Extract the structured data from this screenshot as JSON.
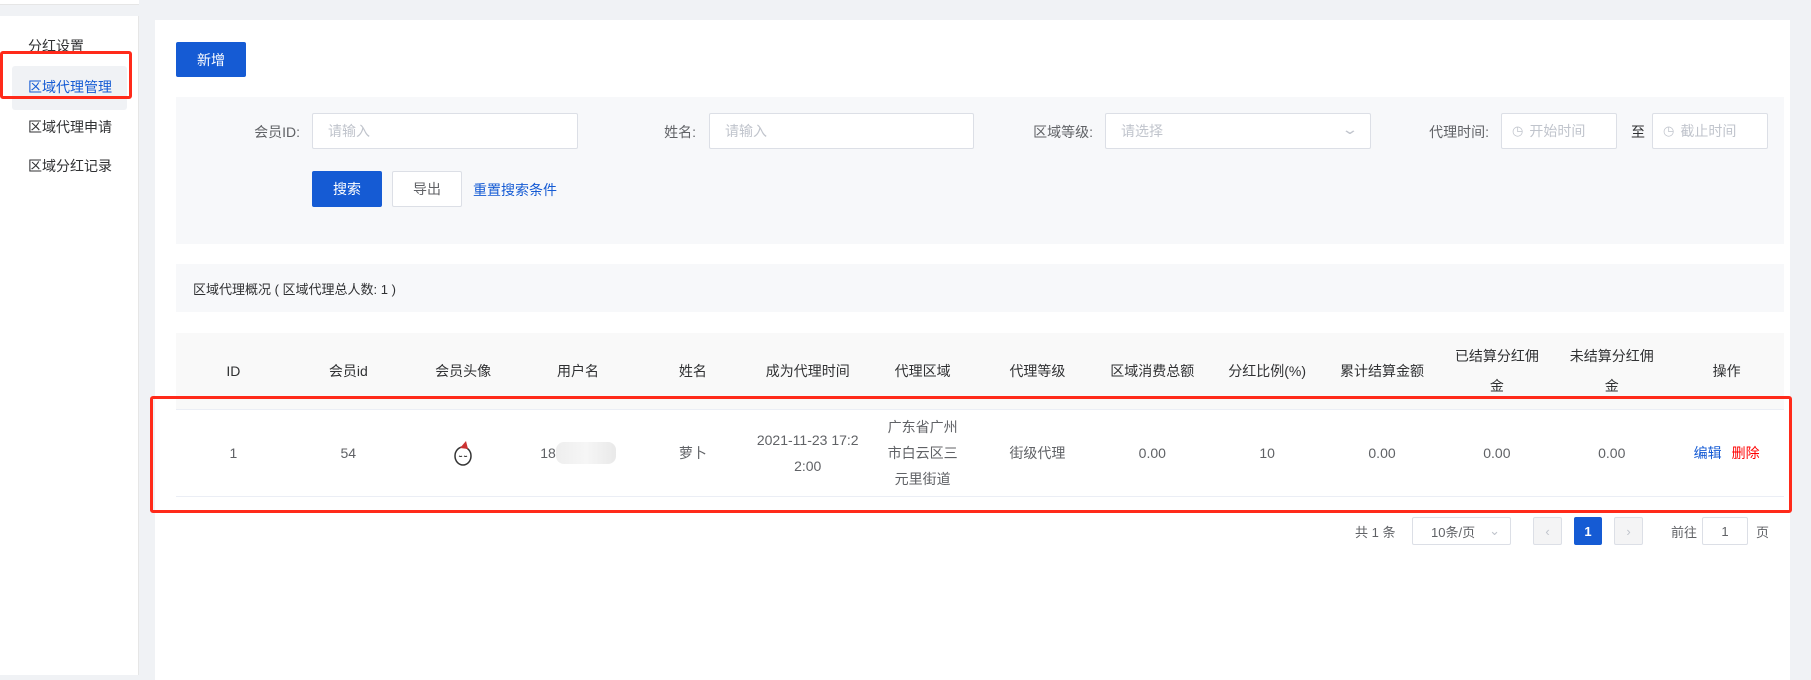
{
  "sidebar": {
    "items": [
      {
        "label": "分红设置"
      },
      {
        "label": "区域代理管理"
      },
      {
        "label": "区域代理申请"
      },
      {
        "label": "区域分红记录"
      }
    ]
  },
  "toolbar": {
    "add_label": "新增"
  },
  "filters": {
    "member_id": {
      "label": "会员ID:",
      "placeholder": "请输入"
    },
    "name": {
      "label": "姓名:",
      "placeholder": "请输入"
    },
    "level": {
      "label": "区域等级:",
      "placeholder": "请选择"
    },
    "time": {
      "label": "代理时间:",
      "start_placeholder": "开始时间",
      "sep": "至",
      "end_placeholder": "截止时间"
    },
    "search_label": "搜索",
    "export_label": "导出",
    "reset_label": "重置搜索条件"
  },
  "summary": {
    "text": "区域代理概况 ( 区域代理总人数: 1 )"
  },
  "table": {
    "headers": [
      "ID",
      "会员id",
      "会员头像",
      "用户名",
      "姓名",
      "成为代理时间",
      "代理区域",
      "代理等级",
      "区域消费总额",
      "分红比例(%)",
      "累计结算金额",
      "已结算分红佣金",
      "未结算分红佣金",
      "操作"
    ],
    "rows": [
      {
        "id": "1",
        "member_id": "54",
        "username": "18",
        "name": "萝卜",
        "time": "2021-11-23 17:22:00",
        "region": "广东省广州市白云区三元里街道",
        "level": "街级代理",
        "consume": "0.00",
        "ratio": "10",
        "total": "0.00",
        "settled": "0.00",
        "unsettled": "0.00",
        "edit": "编辑",
        "delete": "删除"
      }
    ]
  },
  "pagination": {
    "total": "共 1 条",
    "page_size": "10条/页",
    "current": "1",
    "goto_label": "前往",
    "goto_value": "1",
    "page_unit": "页"
  },
  "colors": {
    "primary": "#155bd4",
    "danger": "#ff0000",
    "highlight": "#ff2a1a"
  }
}
